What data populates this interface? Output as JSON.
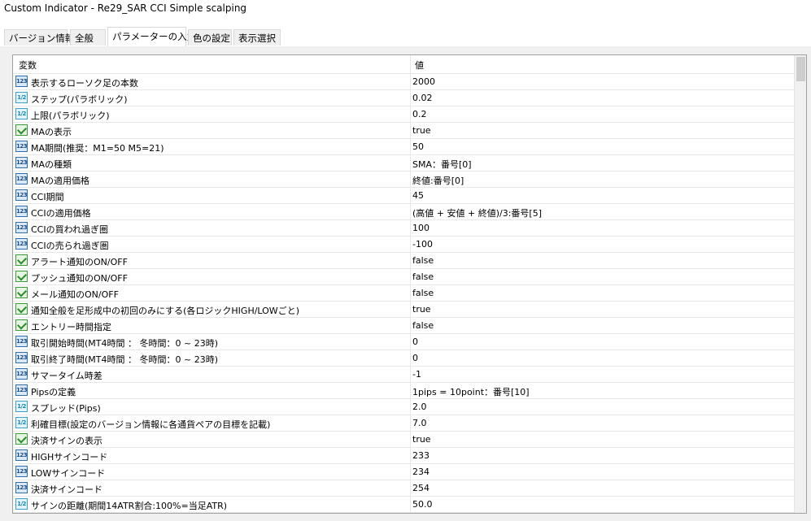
{
  "window": {
    "title": "Custom Indicator - Re29_SAR CCI Simple scalping"
  },
  "tabs": [
    "バージョン情報",
    "全般",
    "パラメーターの入力",
    "色の設定",
    "表示選択"
  ],
  "grid": {
    "col_name": "変数",
    "col_value": "値",
    "rows": [
      {
        "icon": "int",
        "name": "表示するローソク足の本数",
        "value": "2000"
      },
      {
        "icon": "double",
        "name": "ステップ(パラボリック)",
        "value": "0.02"
      },
      {
        "icon": "double",
        "name": "上限(パラボリック)",
        "value": "0.2"
      },
      {
        "icon": "bool",
        "name": "MAの表示",
        "value": "true"
      },
      {
        "icon": "int",
        "name": "MA期間(推奨：M1=50 M5=21)",
        "value": "50"
      },
      {
        "icon": "int",
        "name": "MAの種類",
        "value": "SMA：番号[0]"
      },
      {
        "icon": "int",
        "name": "MAの適用価格",
        "value": "終値:番号[0]"
      },
      {
        "icon": "int",
        "name": "CCI期間",
        "value": "45"
      },
      {
        "icon": "int",
        "name": "CCIの適用価格",
        "value": "(高値 + 安値 + 終値)/3:番号[5]"
      },
      {
        "icon": "int",
        "name": "CCIの買われ過ぎ圏",
        "value": "100"
      },
      {
        "icon": "int",
        "name": "CCIの売られ過ぎ圏",
        "value": "-100"
      },
      {
        "icon": "bool",
        "name": "アラート通知のON/OFF",
        "value": "false"
      },
      {
        "icon": "bool",
        "name": "プッシュ通知のON/OFF",
        "value": "false"
      },
      {
        "icon": "bool",
        "name": "メール通知のON/OFF",
        "value": "false"
      },
      {
        "icon": "bool",
        "name": "通知全般を足形成中の初回のみにする(各ロジックHIGH/LOWごと)",
        "value": "true"
      },
      {
        "icon": "bool",
        "name": "エントリー時間指定",
        "value": "false"
      },
      {
        "icon": "int",
        "name": "取引開始時間(MT4時間 ： 冬時間：0 ~ 23時)",
        "value": "0"
      },
      {
        "icon": "int",
        "name": "取引終了時間(MT4時間 ： 冬時間：0 ~ 23時)",
        "value": "0"
      },
      {
        "icon": "int",
        "name": "サマータイム時差",
        "value": "-1"
      },
      {
        "icon": "int",
        "name": "Pipsの定義",
        "value": "1pips = 10point：番号[10]"
      },
      {
        "icon": "double",
        "name": "スプレッド(Pips)",
        "value": "2.0"
      },
      {
        "icon": "double",
        "name": "利確目標(設定のバージョン情報に各通貨ペアの目標を記載)",
        "value": "7.0"
      },
      {
        "icon": "bool",
        "name": "決済サインの表示",
        "value": "true"
      },
      {
        "icon": "int",
        "name": "HIGHサインコード",
        "value": "233"
      },
      {
        "icon": "int",
        "name": "LOWサインコード",
        "value": "234"
      },
      {
        "icon": "int",
        "name": "決済サインコード",
        "value": "254"
      },
      {
        "icon": "double",
        "name": "サインの距離(期間14ATR割合:100%=当足ATR)",
        "value": "50.0"
      }
    ]
  },
  "icon_labels": {
    "int": "123",
    "double": "1/2"
  }
}
